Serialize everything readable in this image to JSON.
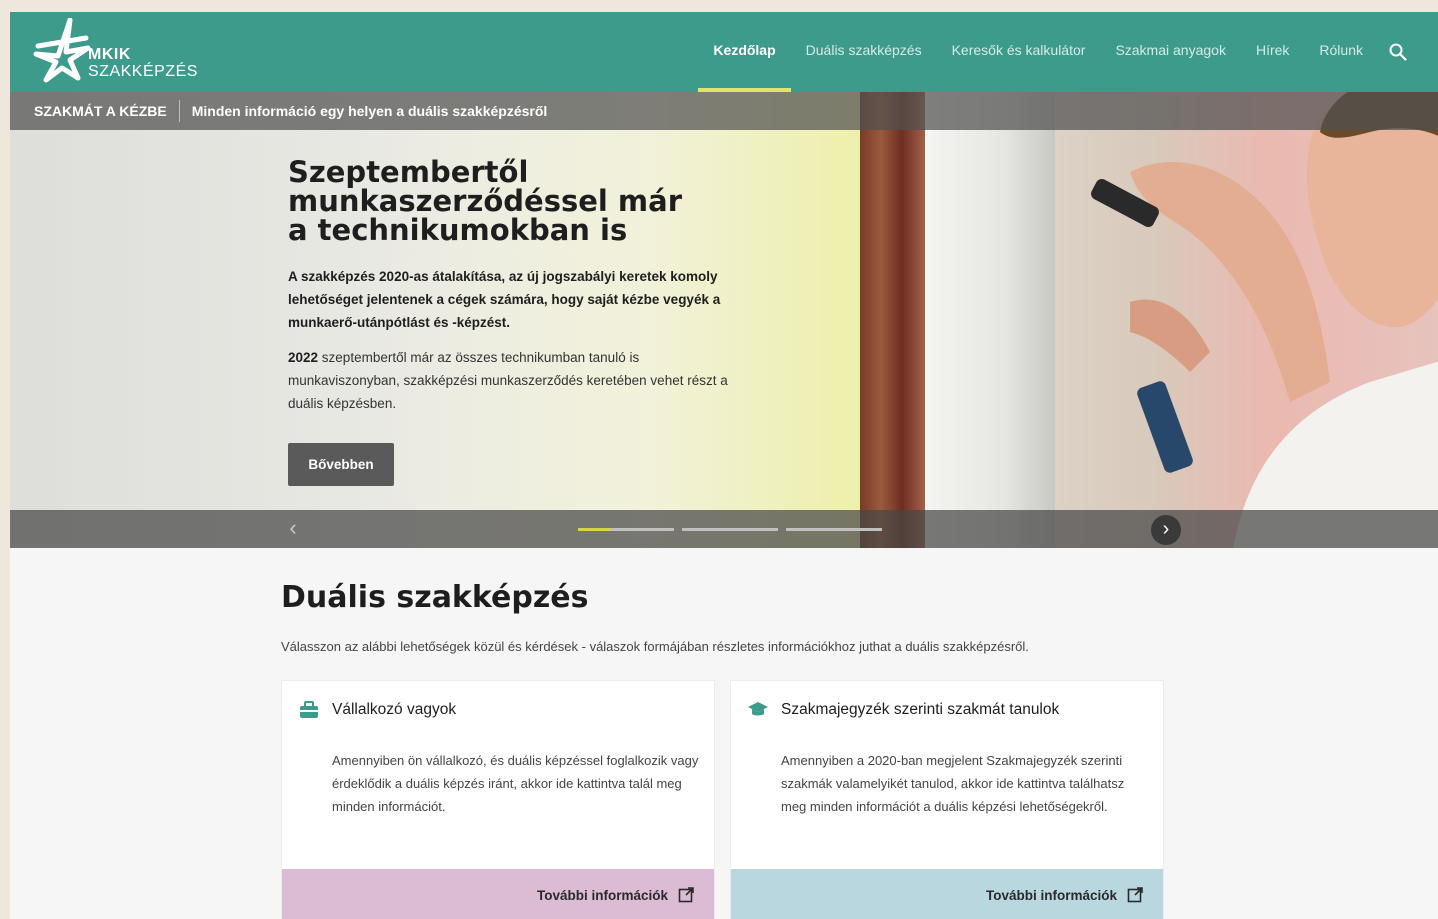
{
  "brand": {
    "line1": "MKIK",
    "line2": "SZAKKÉPZÉS"
  },
  "nav": {
    "items": [
      {
        "label": "Kezdőlap",
        "active": true
      },
      {
        "label": "Duális szakképzés"
      },
      {
        "label": "Keresők és kalkulátor"
      },
      {
        "label": "Szakmai anyagok"
      },
      {
        "label": "Hírek"
      },
      {
        "label": "Rólunk"
      }
    ],
    "search_icon": "search-icon"
  },
  "subbar": {
    "tag": "SZAKMÁT A KÉZBE",
    "text": "Minden információ egy helyen a duális szakképzésről"
  },
  "hero": {
    "title_lines": [
      "Szeptembertől",
      "munkaszerződéssel már",
      "a technikumokban is"
    ],
    "lead": "A szakképzés 2020-as átalakítása, az új jogszabályi keretek komoly lehetőséget jelentenek a cégek számára, hogy saját kézbe vegyék a munkaerő-utánpótlást és -képzést.",
    "body_strong": "2022",
    "body_rest": " szeptembertől már az összes technikumban tanuló is munkaviszonyban, szakképzési munkaszerződés keretében vehet részt a duális képzésben.",
    "button": "Bővebben",
    "slides": 3,
    "active_slide": 1,
    "progress": 0.34
  },
  "section": {
    "title": "Duális szakképzés",
    "desc": "Válasszon az alábbi lehetőségek közül és kérdések - válaszok formájában részletes információkhoz juthat a duális szakképzésről."
  },
  "cards": [
    {
      "icon": "briefcase-icon",
      "title": "Vállalkozó vagyok",
      "body": "Amennyiben ön vállalkozó, és duális képzéssel foglalkozik vagy érdeklődik a duális képzés iránt, akkor ide kattintva talál meg minden információt.",
      "link": "További információk",
      "color": "#dcbcd4"
    },
    {
      "icon": "graduation-cap-icon",
      "title": "Szakmajegyzék szerinti szakmát tanulok",
      "body": "Amennyiben a 2020-ban megjelent Szakmajegyzék szerinti szakmák valamelyikét tanulod, akkor ide kattintva találhatsz meg minden információt a duális képzési lehetőségekről.",
      "link": "További információk",
      "color": "#b9d7df"
    }
  ],
  "colors": {
    "header": "#3d9b8b",
    "accent": "#e4e26f"
  }
}
